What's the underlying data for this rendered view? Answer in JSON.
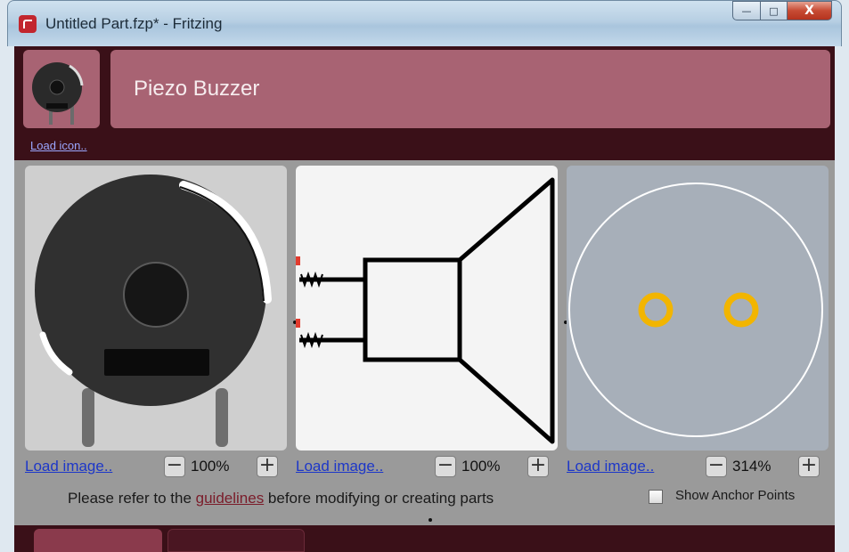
{
  "window": {
    "title": "Untitled Part.fzp* - Fritzing",
    "controls": {
      "minimize": "—",
      "maximize": "□",
      "close": "X"
    }
  },
  "part": {
    "name": "Piezo Buzzer",
    "load_icon_label": "Load icon.."
  },
  "views": [
    {
      "load_label": "Load image..",
      "zoom": "100%",
      "zoom_out": "−",
      "zoom_in": "+"
    },
    {
      "load_label": "Load image..",
      "zoom": "100%",
      "zoom_out": "−",
      "zoom_in": "+"
    },
    {
      "load_label": "Load image..",
      "zoom": "314%",
      "zoom_out": "−",
      "zoom_in": "+"
    }
  ],
  "footer": {
    "guide_prefix": "Please refer to the ",
    "guide_link": "guidelines",
    "guide_suffix": " before modifying or creating parts",
    "show_anchor_label": "Show Anchor Points",
    "show_anchor_checked": false
  },
  "colors": {
    "header_bg": "#3a1018",
    "name_box": "#a86373",
    "pad": "#f2b500",
    "link": "#1d37c8"
  },
  "icons": [
    "app-icon",
    "minimize-icon",
    "maximize-icon",
    "close-icon",
    "zoom-out-icon",
    "zoom-in-icon",
    "checkbox-icon"
  ]
}
